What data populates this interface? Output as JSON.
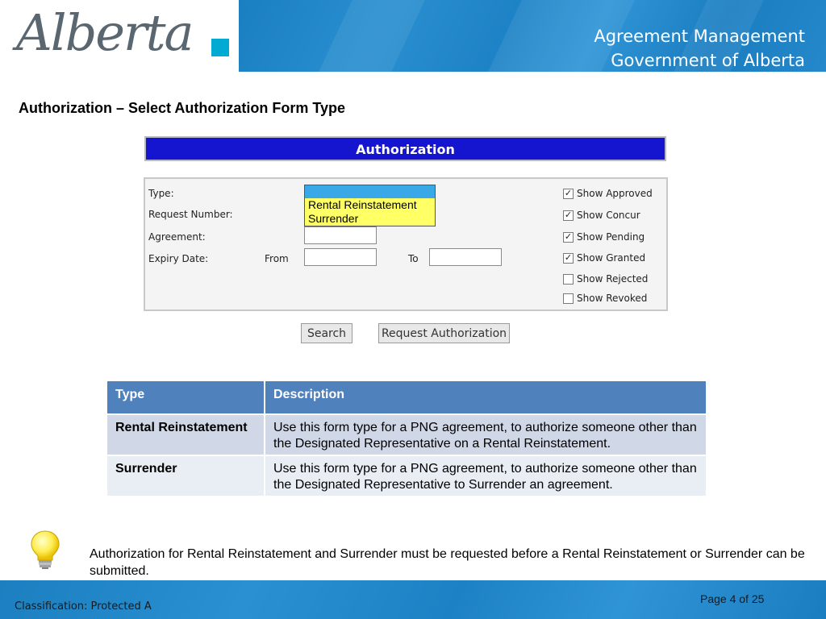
{
  "header": {
    "logo_text": "Alberta",
    "title_line1": "Agreement Management",
    "title_line2": "Government of Alberta"
  },
  "slide": {
    "heading": "Authorization – Select Authorization Form Type"
  },
  "form": {
    "bar_title": "Authorization",
    "labels": {
      "type": "Type:",
      "request_number": "Request Number:",
      "agreement": "Agreement:",
      "expiry_date": "Expiry Date:",
      "from": "From",
      "to": "To"
    },
    "type_dropdown": {
      "options": [
        "Rental Reinstatement",
        "Surrender"
      ]
    },
    "checkboxes": [
      {
        "label": "Show Approved",
        "checked": true
      },
      {
        "label": "Show Concur",
        "checked": true
      },
      {
        "label": "Show Pending",
        "checked": true
      },
      {
        "label": "Show Granted",
        "checked": true
      },
      {
        "label": "Show Rejected",
        "checked": false
      },
      {
        "label": "Show Revoked",
        "checked": false
      }
    ],
    "buttons": {
      "search": "Search",
      "request_authorization": "Request Authorization"
    }
  },
  "table": {
    "headers": [
      "Type",
      "Description"
    ],
    "rows": [
      {
        "type": "Rental Reinstatement",
        "description": "Use this form type for a PNG agreement, to authorize someone other than the Designated Representative on a Rental Reinstatement."
      },
      {
        "type": "Surrender",
        "description": "Use this form type for a PNG agreement, to authorize someone other than the Designated Representative to Surrender an agreement."
      }
    ]
  },
  "tip": {
    "text": "Authorization for Rental Reinstatement and Surrender must be requested before a Rental Reinstatement or Surrender can be submitted."
  },
  "footer": {
    "classification": "Classification: Protected A",
    "page": "Page 4 of 25"
  },
  "colors": {
    "banner_blue": "#1e83c6",
    "auth_bar": "#1515cf",
    "table_header": "#4f81bd",
    "dropdown_highlight": "#ffff66"
  }
}
